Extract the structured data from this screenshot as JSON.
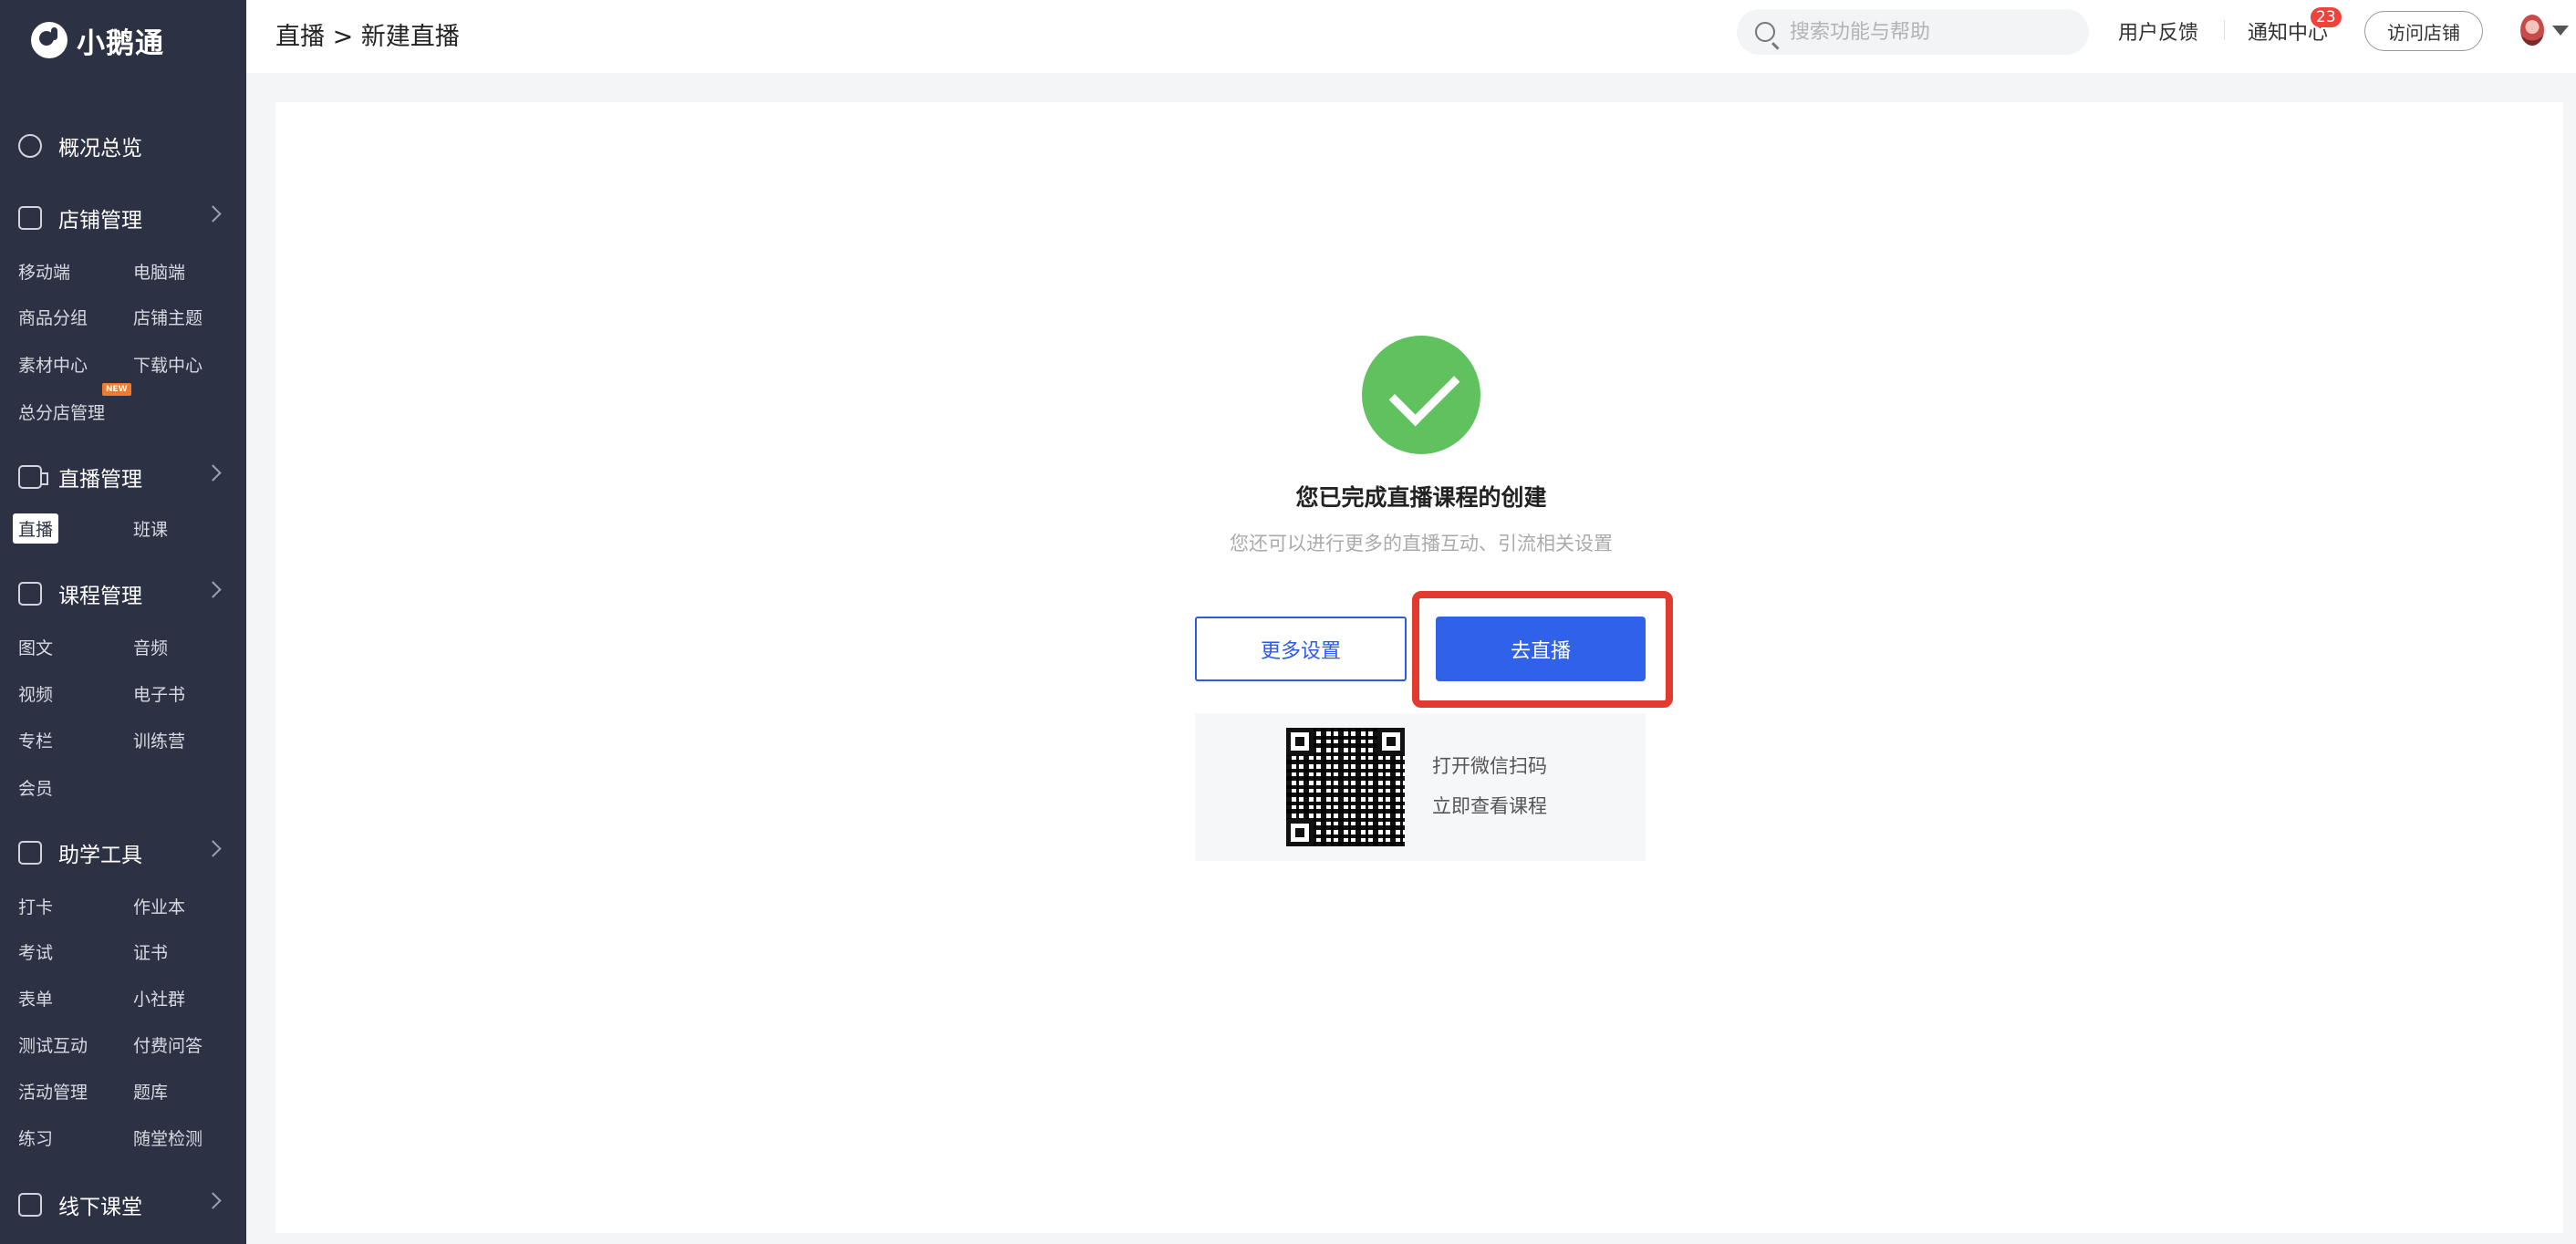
{
  "app": {
    "name": "小鹅通"
  },
  "sidebar": {
    "sections": [
      {
        "label": "概况总览"
      },
      {
        "label": "店铺管理"
      },
      {
        "label": "直播管理"
      },
      {
        "label": "课程管理"
      },
      {
        "label": "助学工具"
      },
      {
        "label": "线下课堂"
      }
    ],
    "store_items": [
      "移动端",
      "电脑端",
      "商品分组",
      "店铺主题",
      "素材中心",
      "下载中心",
      "总分店管理"
    ],
    "new_badge": "NEW",
    "live_items": [
      "直播",
      "班课"
    ],
    "course_items": [
      "图文",
      "音频",
      "视频",
      "电子书",
      "专栏",
      "训练营",
      "会员"
    ],
    "tool_items": [
      "打卡",
      "作业本",
      "考试",
      "证书",
      "表单",
      "小社群",
      "测试互动",
      "付费问答",
      "活动管理",
      "题库",
      "练习",
      "随堂检测"
    ]
  },
  "header": {
    "breadcrumb": "直播 > 新建直播",
    "search_placeholder": "搜索功能与帮助",
    "feedback": "用户反馈",
    "notifications": "通知中心",
    "notification_count": "23",
    "visit_store": "访问店铺"
  },
  "main": {
    "title": "您已完成直播课程的创建",
    "subtitle": "您还可以进行更多的直播互动、引流相关设置",
    "more_settings": "更多设置",
    "go_live": "去直播",
    "qr_line1": "打开微信扫码",
    "qr_line2": "立即查看课程"
  },
  "colors": {
    "sidebar_bg": "#2c3244",
    "primary": "#2f62e9",
    "success": "#60c15f",
    "highlight": "#e23a2e"
  }
}
